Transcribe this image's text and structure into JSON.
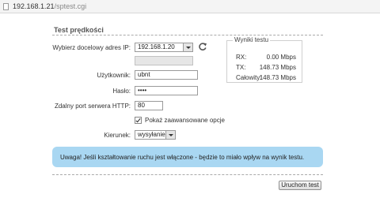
{
  "browser": {
    "url_host": "192.168.1.21",
    "url_path": "/sptest.cgi"
  },
  "section": {
    "title": "Test prędkości"
  },
  "form": {
    "target_ip_label": "Wybierz docelowy adres IP:",
    "target_ip_value": "192.168.1.20",
    "manual_ip_value": "",
    "username_label": "Użytkownik:",
    "username_value": "ubnt",
    "password_label": "Hasło:",
    "password_value": "••••",
    "port_label": "Zdalny port serwera HTTP:",
    "port_value": "80",
    "advanced_checkbox_label": "Pokaż zaawansowane opcje",
    "advanced_checked": true,
    "direction_label": "Kierunek:",
    "direction_value": "wysyłanie"
  },
  "results": {
    "legend": "Wyniki testu",
    "rx_label": "RX:",
    "rx_value": "0.00 Mbps",
    "tx_label": "TX:",
    "tx_value": "148.73 Mbps",
    "total_label": "Całowity:",
    "total_value": "148.73 Mbps"
  },
  "warning": {
    "text": "Uwaga! Jeśli kształtowanie ruchu jest włączone - będzie to miało wpływ na wynik testu."
  },
  "run_button_label": "Uruchom test"
}
